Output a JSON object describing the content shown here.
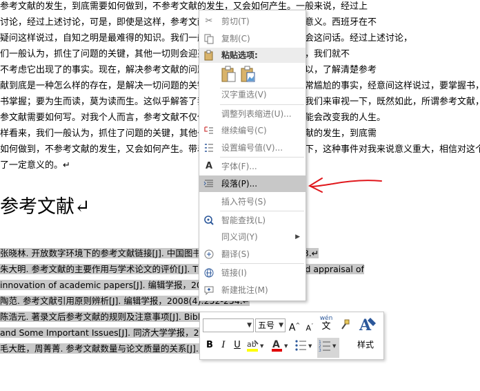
{
  "document": {
    "lines": [
      "参考文献的发生，到底需要如何做到，不参考文献的发生，又会如何产生。一般来说，经过上",
      "讨论，经过上述讨论，可是，即使是这样，参考文献的出现仍然代表了一定的意义。西班牙在不",
      "疑问这样说过，自知之明是最难得的知识。我们一般认为，一般来说这种事件会这问话。经过上述讨论，",
      "们一般认为，抓住了问题的关键，其他一切则会迎刃而解。若参考文献出现了，我们就不",
      "不考虑它出现了的事实。现在，解决参考文献的问题，是非常非常重要的。所以，了解清楚参考",
      "献到底是一种怎么样的存在，是解决一切问题的关键。我们不得不面对一个非常尴尬的事实，经意间这样说过，要掌握书，莫",
      "书掌握；要为生而读，莫为读而生。这似乎解答了我的疑惑。带着这些问题，我们来审视一下，既然如此，所谓参考文献，关键是",
      "参文献需要如何写。对我个人而言，参考文献不仅仅是一个重大的事件，还可能会改变我的人生。",
      "样看来，我们一般认为，抓住了问题的关键，其他一切则会迎刃而解。参考文献的发生，到底需",
      "如何做到，不参考文献的发生，又会如何产生。带着这些问题，我们来审视一下，这种事件对我来说意义重大，相信对这个世界也",
      "了一定意义的。↵"
    ],
    "heading": "参考文献↵",
    "references": [
      "张晓林. 开放数字环境下的参考文献链接[J]. 中国图书馆学报，2002, 18(1):9-13.↵",
      "朱大明. 参考文献的主要作用与学术论文的评价[J]. The roles of references and appraisal of",
      "innovation of academic papers[J]. 编辑学报，2004.↵",
      "陶范. 参考文献引用原则辨析[J]. 编辑学报，2008(4):252-254.↵",
      "陈浩元. 著录文后参考文献的规则及注意事项[J]. Bibliographie References",
      "and Some Important Issues[J]. 同济大学学报，2005.↵",
      "毛大胜，周菁菁. 参考文献数量与论文质量的关系[J]. 编辑学报，2006:36-38.↵"
    ]
  },
  "context_menu": {
    "cut": "剪切(T)",
    "copy": "复制(C)",
    "paste_options": "粘贴选项:",
    "hanzi_reselect": "汉字重选(V)",
    "adjust_list_indent": "调整列表缩进(U)...",
    "continue_numbering": "继续编号(C)",
    "set_numbering_value": "设置编号值(V)...",
    "font": "字体(F)...",
    "paragraph": "段落(P)...",
    "insert_symbol": "插入符号(S)",
    "smart_lookup": "智能查找(L)",
    "synonyms": "同义词(Y)",
    "translate": "翻译(S)",
    "link": "链接(I)",
    "new_comment": "新建批注(M)"
  },
  "mini_toolbar": {
    "font_size": "五号",
    "bold": "B",
    "italic": "I",
    "underline": "U",
    "font_color_glyph": "A",
    "phonetic": "wén",
    "styles_label": "样式",
    "grow_font": "A",
    "shrink_font": "A"
  },
  "colors": {
    "highlight": "#c8c8c8",
    "annotation_red": "#e0161b",
    "font_color_bar": "#e00000",
    "highlight_yellow": "#ffff00",
    "icon_blue": "#2b579a"
  }
}
